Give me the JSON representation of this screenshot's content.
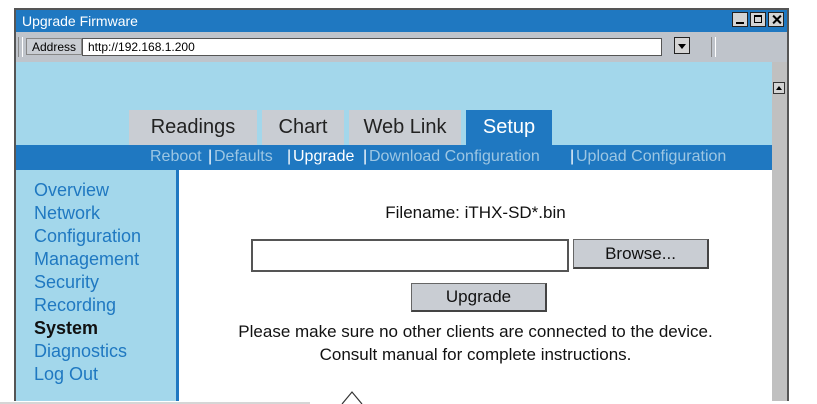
{
  "window": {
    "title": "Upgrade Firmware"
  },
  "address_bar": {
    "label": "Address",
    "url": "http://192.168.1.200"
  },
  "tabs": [
    {
      "label": "Readings"
    },
    {
      "label": "Chart"
    },
    {
      "label": "Web Link"
    },
    {
      "label": "Setup"
    }
  ],
  "subnav": [
    {
      "label": "Reboot"
    },
    {
      "label": "Defaults"
    },
    {
      "label": "Upgrade"
    },
    {
      "label": "Download Configuration"
    },
    {
      "label": "Upload Configuration"
    }
  ],
  "sidebar": {
    "items": [
      {
        "label": "Overview"
      },
      {
        "label": "Network"
      },
      {
        "label": "Configuration"
      },
      {
        "label": "Management"
      },
      {
        "label": "Security"
      },
      {
        "label": "Recording"
      },
      {
        "label": "System"
      },
      {
        "label": "Diagnostics"
      },
      {
        "label": "Log Out"
      }
    ]
  },
  "main": {
    "filename_text": "Filename: iTHX-SD*.bin",
    "file_input_value": "",
    "browse_label": "Browse...",
    "upgrade_label": "Upgrade",
    "notice_line1": "Please make sure no other clients are connected to the device.",
    "notice_line2": "Consult manual for complete instructions."
  },
  "colors": {
    "accent": "#1f78c1",
    "panel": "#a3d7eb",
    "chrome": "#bfc4cb"
  }
}
